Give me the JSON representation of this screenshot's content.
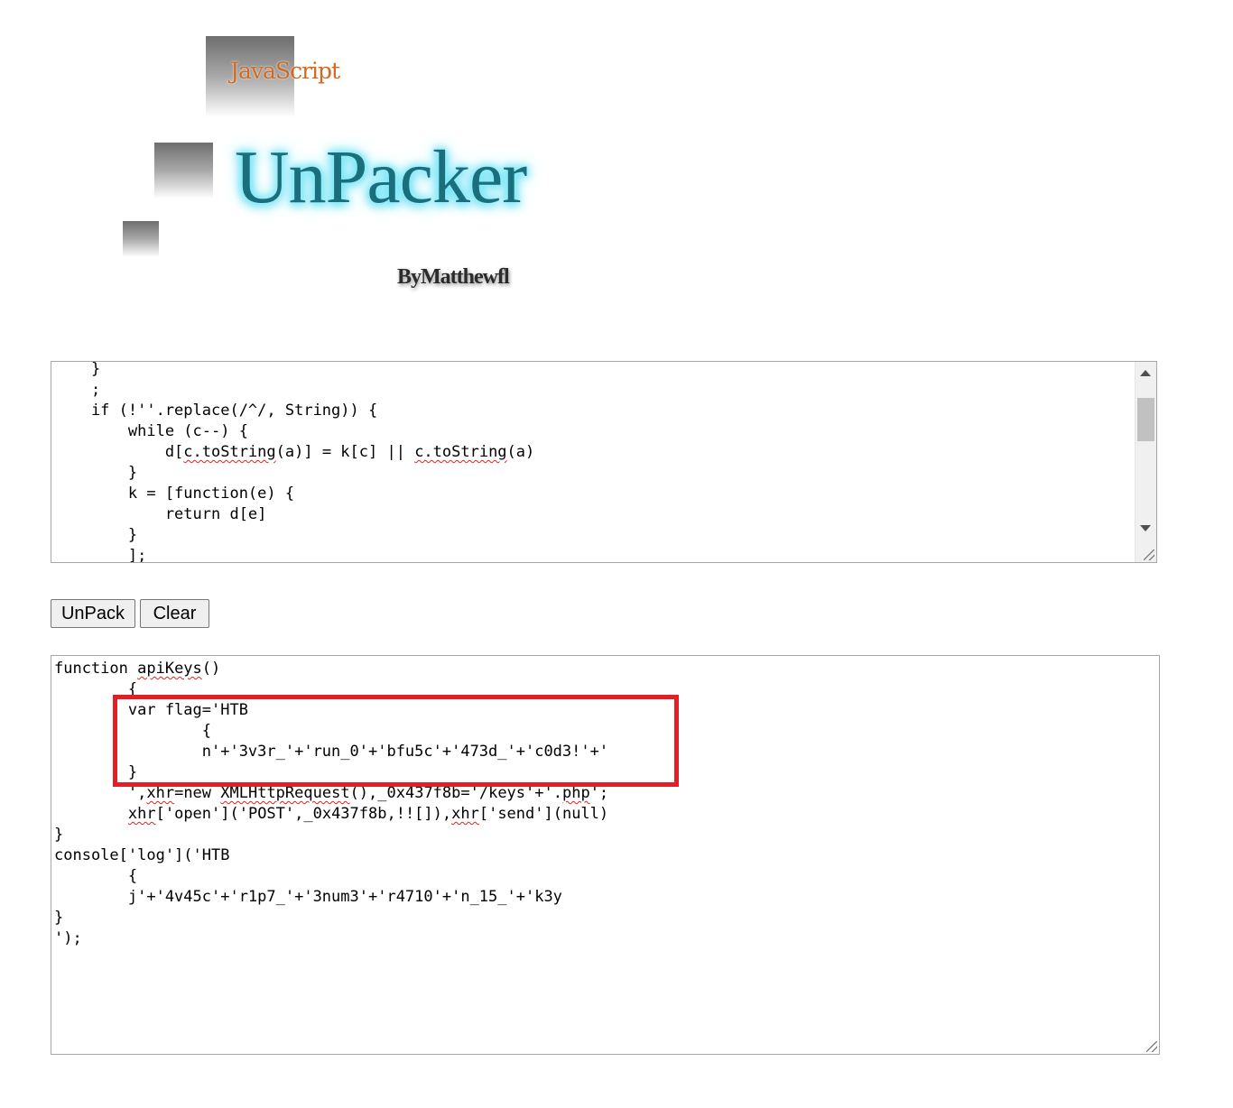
{
  "logo": {
    "javascript_text": "JavaScript",
    "title": "UnPacker",
    "byline": "ByMatthewfl"
  },
  "input": {
    "lines": [
      "    }",
      "    ;",
      "    if (!''.replace(/^/, String)) {",
      "        while (c--) {",
      "            d[c.toString(a)] = k[c] || c.toString(a)",
      "        }",
      "        k = [function(e) {",
      "            return d[e]",
      "        }",
      "        ];"
    ]
  },
  "buttons": {
    "unpack_label": "UnPack",
    "clear_label": "Clear"
  },
  "output": {
    "lines": [
      "function apiKeys()",
      "        {",
      "        var flag='HTB",
      "                {",
      "                n'+'3v3r_'+'run_0'+'bfu5c'+'473d_'+'c0d3!'+'",
      "        }",
      "        ',xhr=new XMLHttpRequest(),_0x437f8b='/keys'+'.php';",
      "        xhr['open']('POST',_0x437f8b,!![]),xhr['send'](null)",
      "}",
      "console['log']('HTB",
      "        {",
      "        j'+'4v45c'+'r1p7_'+'3num3'+'r4710'+'n_15_'+'k3y",
      "}",
      "');"
    ]
  },
  "colors": {
    "highlight": "#e31e24",
    "logo_title": "#1b6e7c",
    "logo_glow": "#6fe8fb",
    "logo_js": "#d2691e"
  }
}
